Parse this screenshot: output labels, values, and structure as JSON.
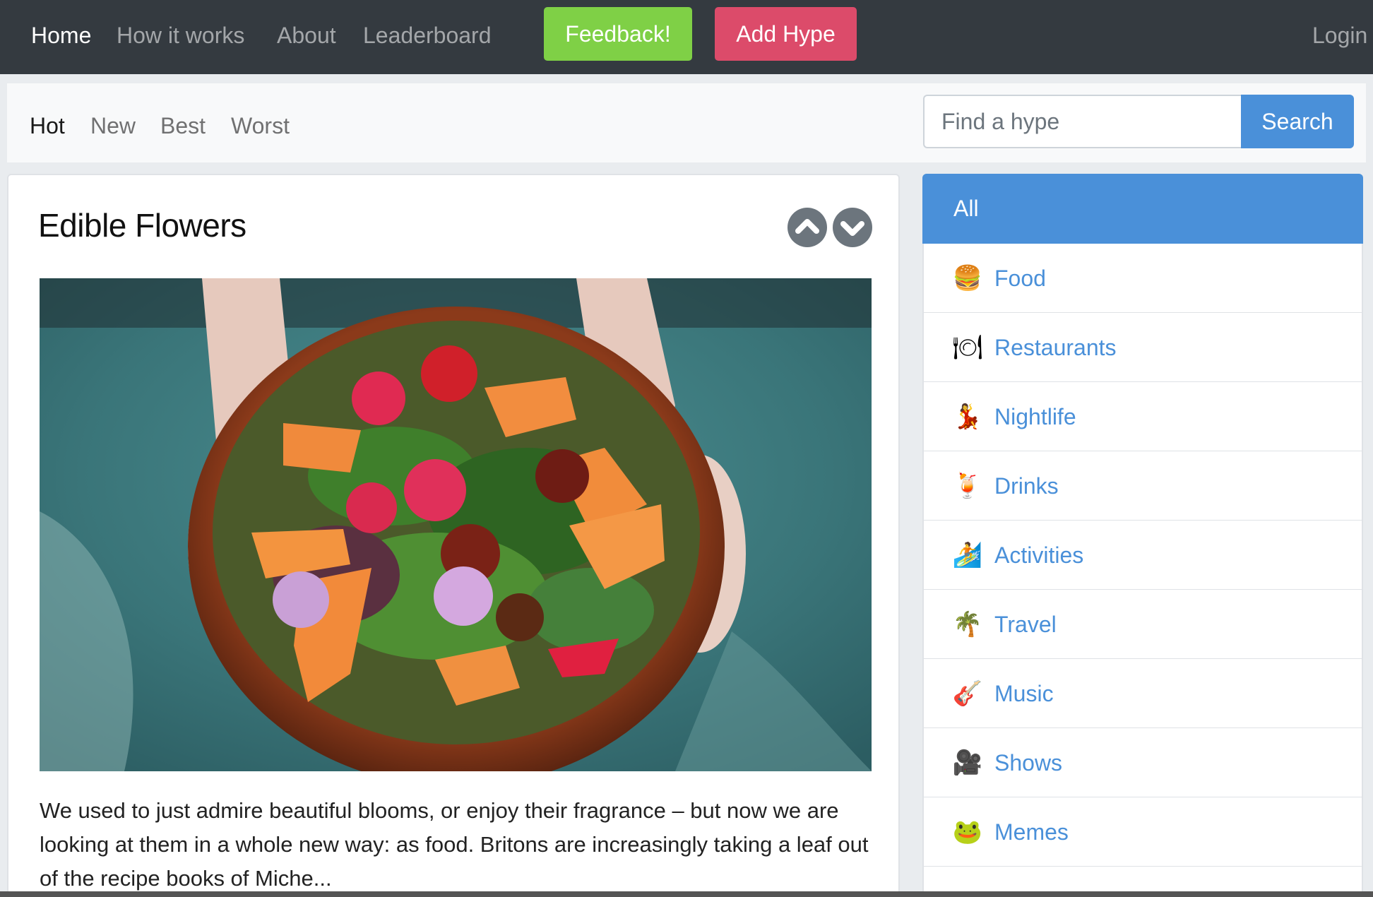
{
  "navbar": {
    "links": [
      {
        "label": "Home",
        "active": true
      },
      {
        "label": "How it works",
        "active": false
      },
      {
        "label": "About",
        "active": false
      },
      {
        "label": "Leaderboard",
        "active": false
      }
    ],
    "feedback_label": "Feedback!",
    "add_hype_label": "Add Hype",
    "login_label": "Login"
  },
  "sort_tabs": [
    {
      "label": "Hot",
      "active": true
    },
    {
      "label": "New",
      "active": false
    },
    {
      "label": "Best",
      "active": false
    },
    {
      "label": "Worst",
      "active": false
    }
  ],
  "search": {
    "placeholder": "Find a hype",
    "value": "",
    "button_label": "Search"
  },
  "post": {
    "title": "Edible Flowers",
    "upvote_icon": "chevron-up-circle-icon",
    "downvote_icon": "chevron-down-circle-icon",
    "image_subject": "salad-bowl-with-edible-flowers",
    "excerpt": "We used to just admire beautiful blooms, or enjoy their fragrance – but now we are looking at them in a whole new way: as food. Britons are increasingly taking a leaf out of the recipe books of Miche..."
  },
  "categories": [
    {
      "label": "All",
      "icon": "",
      "active": true
    },
    {
      "label": "Food",
      "icon": "🍔",
      "active": false
    },
    {
      "label": "Restaurants",
      "icon": "🍽",
      "active": false
    },
    {
      "label": "Nightlife",
      "icon": "💃",
      "active": false
    },
    {
      "label": "Drinks",
      "icon": "🍹",
      "active": false
    },
    {
      "label": "Activities",
      "icon": "🏄",
      "active": false
    },
    {
      "label": "Travel",
      "icon": "🌴",
      "active": false
    },
    {
      "label": "Music",
      "icon": "🎸",
      "active": false
    },
    {
      "label": "Shows",
      "icon": "🎥",
      "active": false
    },
    {
      "label": "Memes",
      "icon": "🐸",
      "active": false
    }
  ],
  "colors": {
    "navbar_bg": "#343a40",
    "feedback": "#7fd046",
    "add_hype": "#dc4b6a",
    "primary": "#4a90d9",
    "vote": "#6c757d"
  }
}
